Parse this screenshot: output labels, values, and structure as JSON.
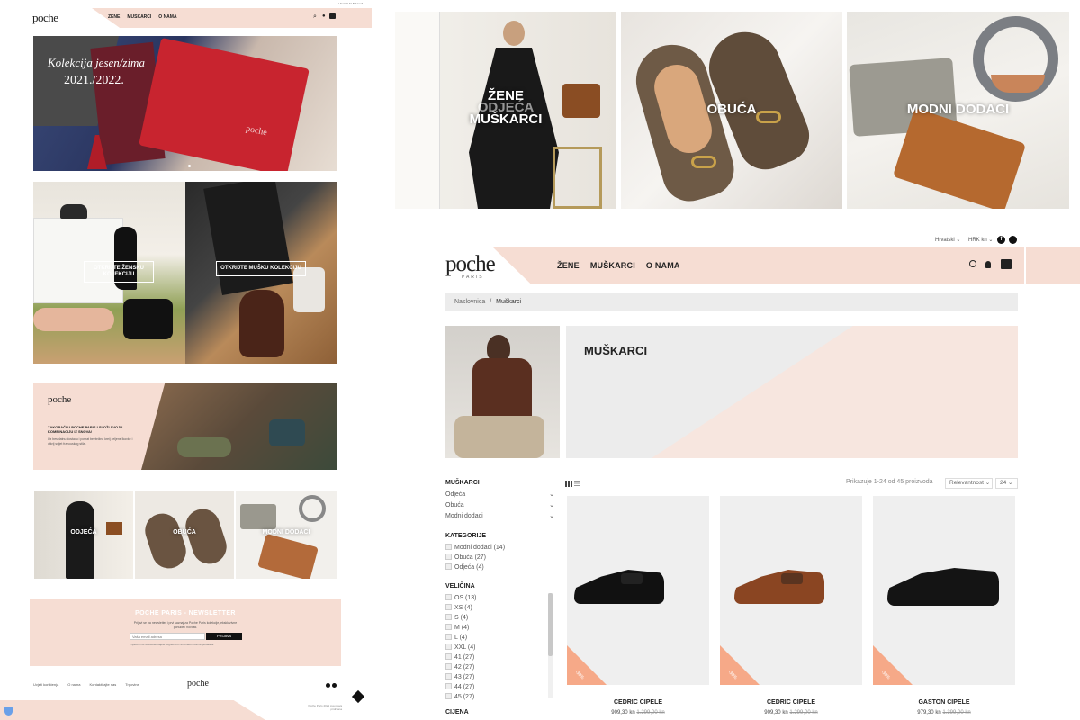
{
  "colors": {
    "pink": "#f6ddd3",
    "salmon": "#f6a988",
    "dark": "#222222"
  },
  "mini": {
    "top_bar": "Hrvatski ▾  HRK kn ▾",
    "logo": "poche",
    "nav": [
      "ŽENE",
      "MUŠKARCI",
      "O NAMA"
    ],
    "hero_text_line1": "Kolekcija jesen/zima",
    "hero_text_line2": "2021./2022.",
    "hero_bag_logo": "poche",
    "btn_women": "OTKRIJTE ŽENSKU KOLEKCIJU",
    "btn_men": "OTKRIJTE MUŠKU KOLEKCIJU",
    "promo_logo": "poche",
    "promo_title": "ZAKORAČI U POCHE PARIS I SLOŽI SVOJU KOMBINACIJU IZ SNOVA!",
    "promo_text": "Uz besplatnu dostavu i povrat bezbrižno kreij željene lkovke i otkrij svijet francuskog stila.",
    "cat1": "ODJEĆA",
    "cat2": "OBUĆA",
    "cat3": "MODNI DODACI",
    "newsletter_title": "POCHE PARIS - NEWSLETTER",
    "newsletter_text": "Prijavi se na newsletter i prvi saznaj za Poche Paris kolekcije, ekskluzivne ponude i novosti.",
    "newsletter_placeholder": "Vaša email adresa",
    "newsletter_button": "PRIJAVA",
    "newsletter_small": "Prijavom na newsletter dajete suglasnost za obradu osobnih podataka.",
    "footer_links": [
      "Uvjeti korištenja",
      "O nama",
      "Kontaktirajte nas",
      "Trgovine"
    ],
    "footer_logo": "poche",
    "copyright": "Poche Paris 2021 sva prava pridržana"
  },
  "banner": {
    "tile1_a": "ŽENE",
    "tile1_b": "ODJEĆA",
    "tile1_c": "MUŠKARCI",
    "tile2": "OBUĆA",
    "tile3": "MODNI DODACI"
  },
  "header": {
    "language": "Hrvatski",
    "currency": "HRK kn",
    "logo": "poche",
    "logo_sub": "PARIS",
    "nav": [
      "ŽENE",
      "MUŠKARCI",
      "O NAMA"
    ]
  },
  "breadcrumb": {
    "home": "Naslovnica",
    "sep": "/",
    "current": "Muškarci"
  },
  "category_title": "MUŠKARCI",
  "sidebar": {
    "main_title": "MUŠKARCI",
    "main_items": [
      "Odjeća",
      "Obuća",
      "Modni dodaci"
    ],
    "cat_title": "KATEGORIJE",
    "cat_items": [
      "Modni dodaci (14)",
      "Obuća (27)",
      "Odjeća (4)"
    ],
    "size_title": "VELIČINA",
    "size_items": [
      "OS (13)",
      "XS (4)",
      "S (4)",
      "M (4)",
      "L (4)",
      "XXL (4)",
      "41 (27)",
      "42 (27)",
      "43 (27)",
      "44 (27)",
      "45 (27)"
    ],
    "price_title": "CIJENA"
  },
  "toolbar": {
    "result_text": "Prikazuje 1-24 od 45 proizvoda",
    "sort": "Relevantnost",
    "per_page": "24"
  },
  "products": [
    {
      "name": "CEDRIC CIPELE",
      "price": "909,30 kn",
      "old_price": "1.299,00 kn",
      "discount": "-30%",
      "color": "#111111"
    },
    {
      "name": "CEDRIC CIPELE",
      "price": "909,30 kn",
      "old_price": "1.299,00 kn",
      "discount": "-30%",
      "color": "#8a4522"
    },
    {
      "name": "GASTON CIPELE",
      "price": "979,30 kn",
      "old_price": "1.399,00 kn",
      "discount": "-30%",
      "color": "#141414"
    }
  ]
}
